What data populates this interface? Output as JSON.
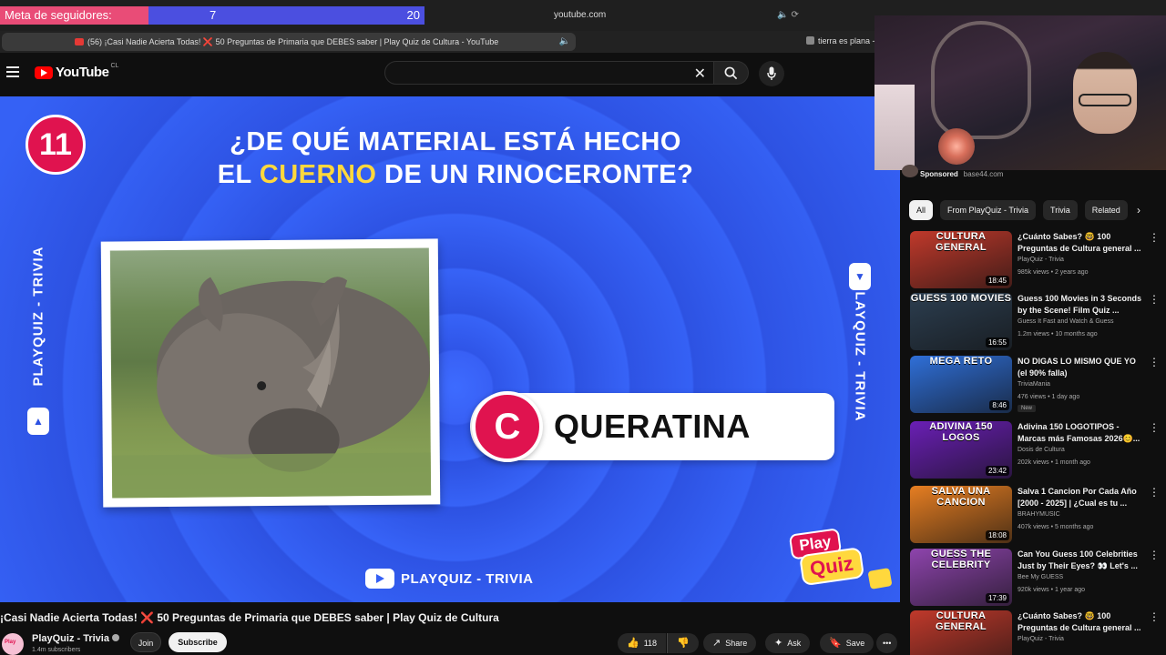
{
  "browser": {
    "goal_label": "Meta de seguidores:",
    "goal_current": "7",
    "goal_target": "20",
    "domain": "youtube.com",
    "tab_active": "(56) ¡Casi Nadie Acierta Todas! ❌ 50 Preguntas de Primaria que DEBES saber | Play Quiz de Cultura - YouTube",
    "tab_other": "tierra es plana -"
  },
  "header": {
    "logo": "YouTube",
    "country": "CL"
  },
  "video": {
    "question_number": "11",
    "question_line1": "¿DE QUÉ MATERIAL ESTÁ HECHO",
    "question_line2_pre": "EL ",
    "question_line2_hl": "CUERNO",
    "question_line2_post": " DE UN RINOCERONTE?",
    "side_text": "PLAYQUIZ - TRIVIA",
    "answer_letter": "C",
    "answer_text": "QUERATINA",
    "channel_mark": "PLAYQUIZ - TRIVIA",
    "logo_play": "Play",
    "logo_quiz": "Quiz"
  },
  "below": {
    "title_pre": "¡Casi Nadie Acierta Todas! ",
    "title_x": "❌",
    "title_post": " 50 Preguntas de Primaria que DEBES saber | Play Quiz de Cultura",
    "channel": "PlayQuiz - Trivia",
    "subs": "1.4m subscribers",
    "join": "Join",
    "subscribe": "Subscribe",
    "likes": "118",
    "share": "Share",
    "ask": "Ask",
    "save": "Save"
  },
  "sidebar": {
    "sponsored_label": "Sponsored",
    "sponsored_domain": "base44.com",
    "chips": [
      "All",
      "From PlayQuiz - Trivia",
      "Trivia",
      "Related"
    ],
    "recs": [
      {
        "title": "¿Cuánto Sabes? 🤓 100 Preguntas de Cultura general ...",
        "channel": "PlayQuiz - Trivia",
        "meta": "985k views • 2 years ago",
        "duration": "18:45",
        "thumb_label": "CULTURA GENERAL",
        "thumb_color": "#c0392b",
        "new": ""
      },
      {
        "title": "Guess 100 Movies in 3 Seconds by the Scene! Film Quiz ...",
        "channel": "Guess It Fast and Watch & Guess",
        "meta": "1.2m views • 10 months ago",
        "duration": "16:55",
        "thumb_label": "GUESS 100 MOVIES",
        "thumb_color": "#2c3e50",
        "new": ""
      },
      {
        "title": "NO DIGAS LO MISMO QUE YO (el 90% falla)",
        "channel": "TriviaMania",
        "meta": "476 views • 1 day ago",
        "duration": "8:46",
        "thumb_label": "MEGA RETO",
        "thumb_color": "#2f6fd8",
        "new": "New"
      },
      {
        "title": "Adivina 150 LOGOTIPOS - Marcas más Famosas 2026😊...",
        "channel": "Dosis de Cultura",
        "meta": "202k views • 1 month ago",
        "duration": "23:42",
        "thumb_label": "ADIVINA 150 LOGOS",
        "thumb_color": "#6a1fb5",
        "new": ""
      },
      {
        "title": "Salva 1 Cancion Por Cada Año [2000 - 2025] | ¿Cual es tu ...",
        "channel": "BRAHYMUSIC",
        "meta": "407k views • 5 months ago",
        "duration": "18:08",
        "thumb_label": "SALVA UNA CANCION",
        "thumb_color": "#e67e22",
        "new": ""
      },
      {
        "title": "Can You Guess 100 Celebrities Just by Their Eyes? 👀 Let's ...",
        "channel": "Bee My GUESS",
        "meta": "920k views • 1 year ago",
        "duration": "17:39",
        "thumb_label": "GUESS THE CELEBRITY",
        "thumb_color": "#8e44ad",
        "new": ""
      },
      {
        "title": "¿Cuánto Sabes? 🤓 100 Preguntas de Cultura general ...",
        "channel": "PlayQuiz - Trivia",
        "meta": "",
        "duration": "",
        "thumb_label": "CULTURA GENERAL",
        "thumb_color": "#c0392b",
        "new": ""
      }
    ]
  }
}
